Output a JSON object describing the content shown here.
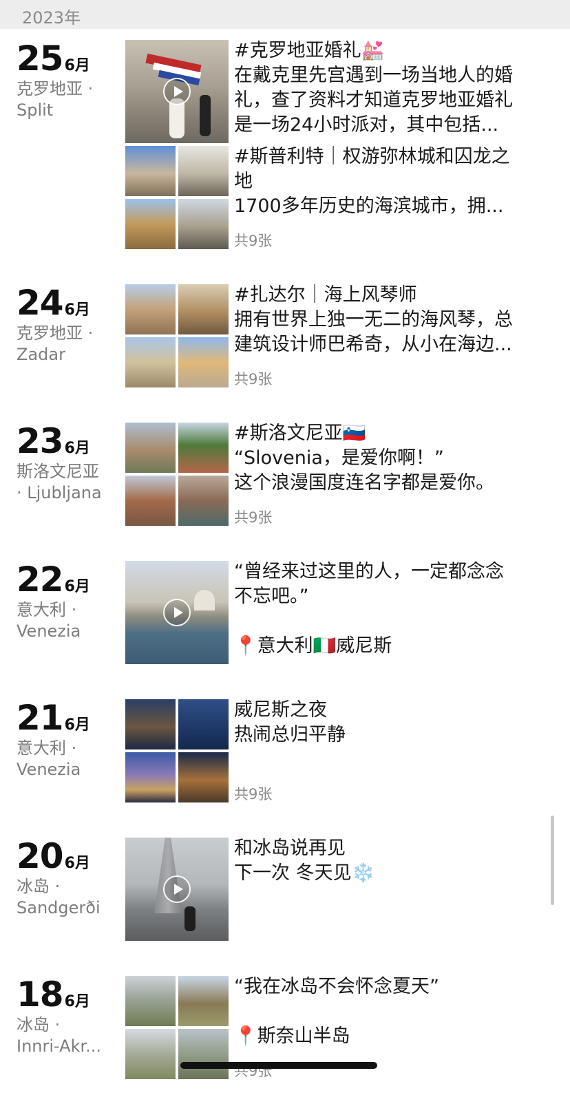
{
  "year_label": "2023年",
  "entries": [
    {
      "day": "25",
      "month": "6月",
      "loc1": "克罗地亚 ·",
      "loc2": "Split",
      "posts": [
        {
          "lines": [
            "#克罗地亚婚礼💒",
            "在戴克里先宫遇到一场当地人的婚",
            "礼，查了资料才知道克罗地亚婚礼",
            "是一场24小时派对，其中包括..."
          ]
        },
        {
          "lines": [
            "#斯普利特｜权游弥林城和囚龙之",
            "地",
            "1700多年历史的海滨城市，拥..."
          ],
          "count": "共9张"
        }
      ]
    },
    {
      "day": "24",
      "month": "6月",
      "loc1": "克罗地亚 ·",
      "loc2": "Zadar",
      "posts": [
        {
          "lines": [
            "#扎达尔｜海上风琴师",
            "拥有世界上独一无二的海风琴，总",
            "建筑设计师巴希奇，从小在海边..."
          ],
          "count": "共9张"
        }
      ]
    },
    {
      "day": "23",
      "month": "6月",
      "loc1": "斯洛文尼亚",
      "loc2": "· Ljubljana",
      "posts": [
        {
          "lines": [
            "#斯洛文尼亚🇸🇮",
            "“Slovenia，是爱你啊！”",
            "这个浪漫国度连名字都是爱你。"
          ],
          "count": "共9张"
        }
      ]
    },
    {
      "day": "22",
      "month": "6月",
      "loc1": "意大利 ·",
      "loc2": "Venezia",
      "posts": [
        {
          "lines": [
            "“曾经来过这里的人，一定都念念",
            "不忘吧。”",
            "",
            "📍意大利🇮🇹威尼斯"
          ]
        }
      ]
    },
    {
      "day": "21",
      "month": "6月",
      "loc1": "意大利 ·",
      "loc2": "Venezia",
      "posts": [
        {
          "lines": [
            "威尼斯之夜",
            "热闹总归平静"
          ],
          "count": "共9张"
        }
      ]
    },
    {
      "day": "20",
      "month": "6月",
      "loc1": "冰岛 ·",
      "loc2": "Sandgerði",
      "posts": [
        {
          "lines": [
            "和冰岛说再见",
            "下一次 冬天见❄️"
          ]
        }
      ]
    },
    {
      "day": "18",
      "month": "6月",
      "loc1": "冰岛 ·",
      "loc2": "Innri-Akr...",
      "posts": [
        {
          "lines": [
            "“我在冰岛不会怀念夏天”",
            "",
            "📍斯奈山半岛"
          ],
          "count": "共9张"
        }
      ]
    }
  ]
}
